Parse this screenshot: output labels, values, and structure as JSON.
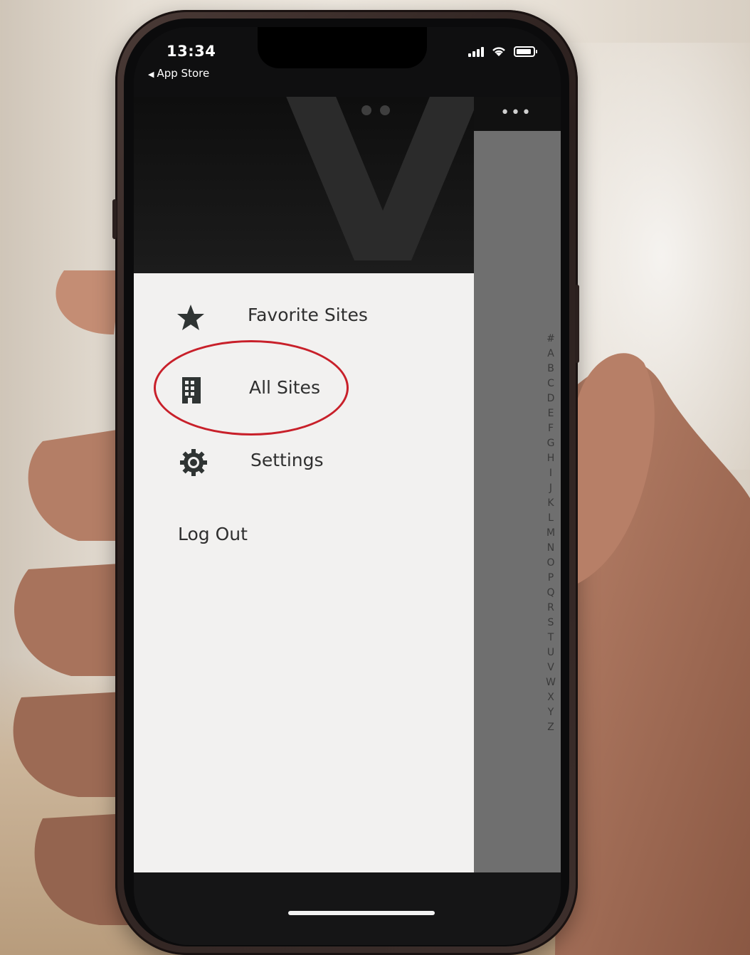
{
  "status_bar": {
    "time": "13:34",
    "back_label": "App Store"
  },
  "app": {
    "more_label": "•••",
    "index_letters": [
      "#",
      "A",
      "B",
      "C",
      "D",
      "E",
      "F",
      "G",
      "H",
      "I",
      "J",
      "K",
      "L",
      "M",
      "N",
      "O",
      "P",
      "Q",
      "R",
      "S",
      "T",
      "U",
      "V",
      "W",
      "X",
      "Y",
      "Z"
    ]
  },
  "menu": {
    "items": [
      {
        "label": "Favorite Sites",
        "icon": "star-icon"
      },
      {
        "label": "All Sites",
        "icon": "building-icon"
      },
      {
        "label": "Settings",
        "icon": "gear-icon"
      }
    ],
    "logout_label": "Log Out"
  },
  "colors": {
    "highlight": "#c8202a",
    "drawer_bg": "#f2f1f0",
    "text": "#2f2f2f"
  }
}
